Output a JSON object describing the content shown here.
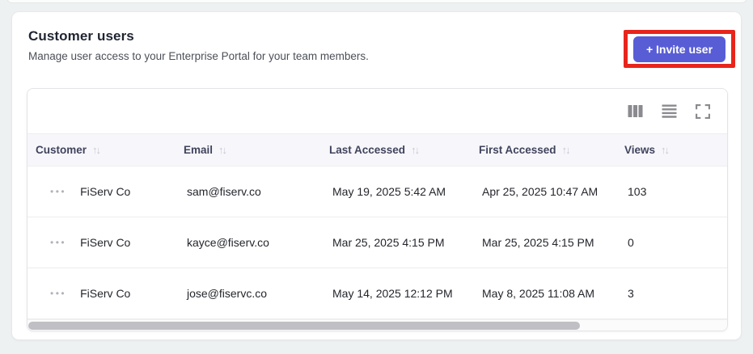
{
  "panel": {
    "title": "Customer users",
    "subtitle": "Manage user access to your Enterprise Portal for your team members.",
    "invite_button_label": "+ Invite user"
  },
  "colors": {
    "accent_button": "#585dd6",
    "highlight_outline": "#e8251c",
    "header_row_bg": "#f7f7fb"
  },
  "glyphs": {
    "sort": "↑↓",
    "row_actions": "•••"
  },
  "toolbar": {
    "icons": [
      {
        "name": "columns-icon"
      },
      {
        "name": "density-icon"
      },
      {
        "name": "fullscreen-icon"
      }
    ]
  },
  "table": {
    "columns": [
      {
        "label": "Customer"
      },
      {
        "label": "Email"
      },
      {
        "label": "Last Accessed"
      },
      {
        "label": "First Accessed"
      },
      {
        "label": "Views"
      }
    ],
    "rows": [
      {
        "customer": "FiServ Co",
        "email": "sam@fiserv.co",
        "last_accessed": "May 19, 2025 5:42 AM",
        "first_accessed": "Apr 25, 2025 10:47 AM",
        "views": "103"
      },
      {
        "customer": "FiServ Co",
        "email": "kayce@fiserv.co",
        "last_accessed": "Mar 25, 2025 4:15 PM",
        "first_accessed": "Mar 25, 2025 4:15 PM",
        "views": "0"
      },
      {
        "customer": "FiServ Co",
        "email": "jose@fiservc.co",
        "last_accessed": "May 14, 2025 12:12 PM",
        "first_accessed": "May 8, 2025 11:08 AM",
        "views": "3"
      }
    ]
  }
}
